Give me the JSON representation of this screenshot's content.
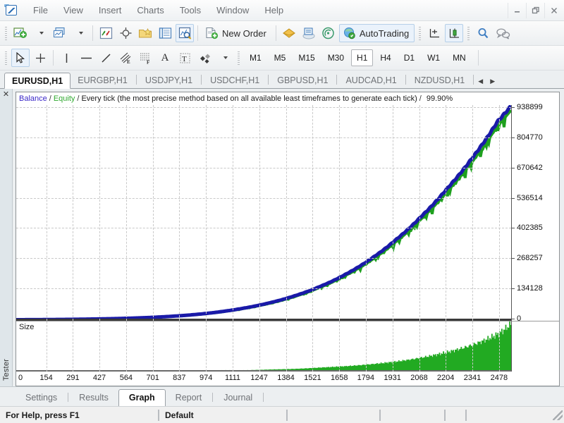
{
  "app": {
    "logo_icon": "metatrader-logo-icon",
    "window_buttons": [
      {
        "name": "minimize-button",
        "glyph": "minimize-icon"
      },
      {
        "name": "restore-button",
        "glyph": "restore-icon"
      },
      {
        "name": "close-button",
        "glyph": "close-icon"
      }
    ]
  },
  "menu": {
    "items": [
      {
        "label": "File"
      },
      {
        "label": "View"
      },
      {
        "label": "Insert"
      },
      {
        "label": "Charts"
      },
      {
        "label": "Tools"
      },
      {
        "label": "Window"
      },
      {
        "label": "Help"
      }
    ]
  },
  "toolbar_main": {
    "buttons": [
      {
        "name": "new-chart-button",
        "icon": "new-chart-icon",
        "label": ""
      },
      {
        "name": "new-chart-dropdown",
        "icon": "chevron-down-icon",
        "label": ""
      },
      {
        "name": "profiles-button",
        "icon": "profiles-icon",
        "label": ""
      },
      {
        "name": "profiles-dropdown",
        "icon": "chevron-down-icon",
        "label": ""
      },
      {
        "name": "market-watch-button",
        "icon": "market-watch-icon",
        "label": ""
      },
      {
        "name": "data-window-button",
        "icon": "crosshair-target-icon",
        "label": ""
      },
      {
        "name": "navigator-button",
        "icon": "navigator-folder-star-icon",
        "label": ""
      },
      {
        "name": "terminal-button",
        "icon": "terminal-list-icon",
        "label": ""
      },
      {
        "name": "strategy-tester-button",
        "icon": "strategy-tester-magnifier-icon",
        "label": ""
      },
      {
        "name": "new-order-button",
        "icon": "new-order-icon",
        "label": "New Order"
      },
      {
        "name": "metaeditor-button",
        "icon": "metaeditor-icon",
        "label": ""
      },
      {
        "name": "mql5-community-button",
        "icon": "mql5-community-icon",
        "label": ""
      },
      {
        "name": "signals-button",
        "icon": "signals-broadcast-icon",
        "label": ""
      },
      {
        "name": "autotrading-button",
        "icon": "autotrading-icon",
        "label": "AutoTrading"
      },
      {
        "name": "crosshair-tool-button",
        "icon": "crosshair-measure-icon",
        "label": ""
      },
      {
        "name": "bar-chart-button",
        "icon": "bar-chart-icon",
        "label": ""
      },
      {
        "name": "zoom-button",
        "icon": "magnifier-icon",
        "label": ""
      },
      {
        "name": "chat-button",
        "icon": "chat-bubbles-icon",
        "label": ""
      }
    ]
  },
  "toolbar_tools": {
    "buttons": [
      {
        "name": "cursor-tool",
        "icon": "arrow-cursor-icon",
        "active": true
      },
      {
        "name": "crosshair-tool",
        "icon": "crosshair-icon",
        "active": false
      },
      {
        "name": "vertical-line-tool",
        "icon": "vertical-line-icon",
        "active": false
      },
      {
        "name": "horizontal-line-tool",
        "icon": "horizontal-line-icon",
        "active": false
      },
      {
        "name": "trendline-tool",
        "icon": "trendline-icon",
        "active": false
      },
      {
        "name": "equidistant-channel-tool",
        "icon": "equidistant-channel-icon",
        "active": false
      },
      {
        "name": "fibonacci-tool",
        "icon": "fibonacci-icon",
        "active": false
      },
      {
        "name": "text-tool",
        "icon": "text-a-icon",
        "active": false
      },
      {
        "name": "label-tool",
        "icon": "text-label-icon",
        "active": false
      },
      {
        "name": "shapes-tool",
        "icon": "shapes-icon",
        "active": false
      },
      {
        "name": "shapes-dropdown",
        "icon": "chevron-down-icon",
        "active": false
      }
    ],
    "timeframes": [
      {
        "label": "M1",
        "active": false
      },
      {
        "label": "M5",
        "active": false
      },
      {
        "label": "M15",
        "active": false
      },
      {
        "label": "M30",
        "active": false
      },
      {
        "label": "H1",
        "active": true
      },
      {
        "label": "H4",
        "active": false
      },
      {
        "label": "D1",
        "active": false
      },
      {
        "label": "W1",
        "active": false
      },
      {
        "label": "MN",
        "active": false
      }
    ]
  },
  "chart_tabs": {
    "items": [
      {
        "label": "EURUSD,H1",
        "active": true
      },
      {
        "label": "EURGBP,H1",
        "active": false
      },
      {
        "label": "USDJPY,H1",
        "active": false
      },
      {
        "label": "USDCHF,H1",
        "active": false
      },
      {
        "label": "GBPUSD,H1",
        "active": false
      },
      {
        "label": "AUDCAD,H1",
        "active": false
      },
      {
        "label": "NZDUSD,H1",
        "active": false
      }
    ],
    "nav_prev": "◀",
    "nav_next": "▶"
  },
  "tester_panel": {
    "close_label": "✕",
    "vertical_label": "Tester",
    "tabs": [
      {
        "label": "Settings",
        "active": false
      },
      {
        "label": "Results",
        "active": false
      },
      {
        "label": "Graph",
        "active": true
      },
      {
        "label": "Report",
        "active": false
      },
      {
        "label": "Journal",
        "active": false
      }
    ]
  },
  "graph_header": {
    "balance_label": "Balance",
    "equity_label": "Equity",
    "sep": "/",
    "method_label": "Every tick (the most precise method based on all available least timeframes to generate each tick)",
    "quality_label": "99.90%"
  },
  "size_panel": {
    "label": "Size"
  },
  "status_bar": {
    "help_text": "For Help, press F1",
    "profile": "Default",
    "cells": [
      "",
      "",
      "",
      ""
    ],
    "resize_grip": "resize-grip-icon"
  },
  "colors": {
    "balance_line": "#1a1aa8",
    "equity_line": "#1ea01e",
    "size_bars": "#22aa22",
    "grid": "#c9c9c9",
    "axis": "#555555",
    "accent_tab": "#ffffff"
  },
  "chart_data": {
    "type": "line",
    "title": "Balance / Equity / Every tick (the most precise method based on all available least timeframes to generate each tick) / 99.90%",
    "xlabel": "",
    "ylabel": "",
    "grid": true,
    "legend": [
      "Balance",
      "Equity"
    ],
    "legend_position": "top-left",
    "xlim": [
      0,
      2540
    ],
    "ylim": [
      0,
      938899
    ],
    "xticks": [
      0,
      154,
      291,
      427,
      564,
      701,
      837,
      974,
      1111,
      1247,
      1384,
      1521,
      1658,
      1794,
      1931,
      2068,
      2204,
      2341,
      2478
    ],
    "yticks": [
      0,
      134128,
      268257,
      402385,
      536514,
      670642,
      804770,
      938899
    ],
    "series": [
      {
        "name": "Balance",
        "color": "#1a1aa8",
        "x": [
          0,
          130,
          260,
          390,
          520,
          650,
          780,
          910,
          1040,
          1170,
          1300,
          1430,
          1560,
          1690,
          1820,
          1950,
          2080,
          2210,
          2340,
          2470,
          2540
        ],
        "values": [
          900,
          1400,
          2300,
          3800,
          6000,
          9500,
          15000,
          23000,
          35000,
          52000,
          75000,
          106000,
          147000,
          200000,
          268000,
          353000,
          455000,
          575000,
          710000,
          870000,
          938899
        ]
      },
      {
        "name": "Equity",
        "color": "#1ea01e",
        "x": [
          0,
          130,
          260,
          390,
          520,
          650,
          780,
          910,
          1040,
          1170,
          1300,
          1430,
          1560,
          1690,
          1820,
          1950,
          2080,
          2210,
          2340,
          2470,
          2540
        ],
        "values": [
          880,
          1370,
          2250,
          3700,
          5850,
          9200,
          14500,
          22200,
          34000,
          50500,
          73000,
          103000,
          143000,
          195000,
          261000,
          344000,
          444000,
          562000,
          695000,
          852000,
          920000
        ]
      }
    ],
    "subchart": {
      "type": "bar",
      "name": "Size",
      "color": "#22aa22",
      "x": [
        0,
        130,
        260,
        390,
        520,
        650,
        780,
        910,
        1040,
        1170,
        1300,
        1430,
        1560,
        1690,
        1820,
        1950,
        2080,
        2210,
        2340,
        2470,
        2540
      ],
      "values": [
        0,
        0,
        0,
        0,
        0,
        0,
        1,
        1,
        2,
        2,
        3,
        4,
        6,
        8,
        11,
        15,
        21,
        29,
        40,
        56,
        72
      ]
    }
  }
}
